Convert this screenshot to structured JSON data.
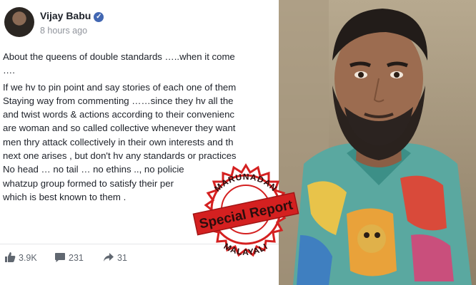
{
  "post": {
    "author": "Vijay Babu",
    "timestamp": "8 hours ago",
    "lines": [
      "About the queens of double standards …..when it come",
      "….",
      "If we hv to pin point and say stories of each one of them",
      "Staying way from commenting ……since they hv all the",
      "and twist words & actions according to their convenienc",
      "are woman and so called collective whenever they want",
      "men thry attack collectively in their own interests and th",
      "next one arises , but don't hv any standards or practices",
      "No head … no tail … no ethins .., no policie",
      "whatzup group formed to satisfy their per",
      "which is best known to them ."
    ]
  },
  "stats": {
    "likes": "3.9K",
    "comments": "231",
    "shares": "31"
  },
  "stamp": {
    "top": "MARUNADAN",
    "center": "Special Report",
    "bottom": "MALAYALI"
  },
  "icons": [
    "verified-badge-icon",
    "like-icon",
    "comment-icon",
    "share-icon"
  ],
  "colors": {
    "accent": "#4267b2",
    "stamp_red": "#d42020",
    "stamp_text": "#2b0d0d"
  }
}
